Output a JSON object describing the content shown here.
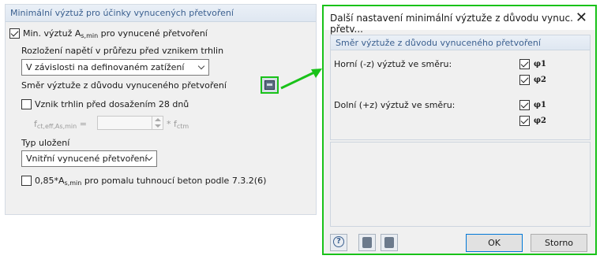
{
  "left_panel": {
    "header": "Minimální výztuž pro účinky vynucených přetvoření",
    "min_reinf": {
      "label_pre": "Min. výztuž A",
      "label_sub": "s,min",
      "label_post": " pro vynucené přetvoření",
      "checked": true
    },
    "stress_dist_label": "Rozložení napětí v průřezu před vznikem trhlin",
    "stress_dist_value": "V závislosti na definovaném zatížení",
    "direction_label": "Směr výztuže z důvodu vynuceného přetvoření",
    "crack_before_28": {
      "label": "Vznik trhlin před dosažením 28 dnů",
      "checked": false
    },
    "fct_label_pre": "f",
    "fct_label_sub": "ct,eff,As,min",
    "fct_label_post": " =",
    "fct_suffix_pre": "* f",
    "fct_suffix_sub": "ctm",
    "storage_label": "Typ uložení",
    "storage_value": "Vnitřní vynucené přetvoření",
    "slow_concrete": {
      "label_pre": "0,85*A",
      "label_sub": "s,min",
      "label_post": " pro pomalu tuhnoucí beton podle 7.3.2(6)",
      "checked": false
    }
  },
  "dialog": {
    "title": "Další nastavení minimální výztuže z důvodu vynuc. přetv...",
    "close_glyph": "✕",
    "group_title": "Směr výztuže z důvodu vynuceného přetvoření",
    "top_label": "Horní (-z) výztuž ve směru:",
    "bottom_label": "Dolní (+z) výztuž ve směru:",
    "phi1": "φ1",
    "phi2": "φ2",
    "top_phi1_checked": true,
    "top_phi2_checked": true,
    "bottom_phi1_checked": true,
    "bottom_phi2_checked": true,
    "help_glyph": "?",
    "ok_label": "OK",
    "cancel_label": "Storno"
  },
  "colors": {
    "highlight": "#19c219",
    "group_header_text": "#3a5f8f"
  }
}
